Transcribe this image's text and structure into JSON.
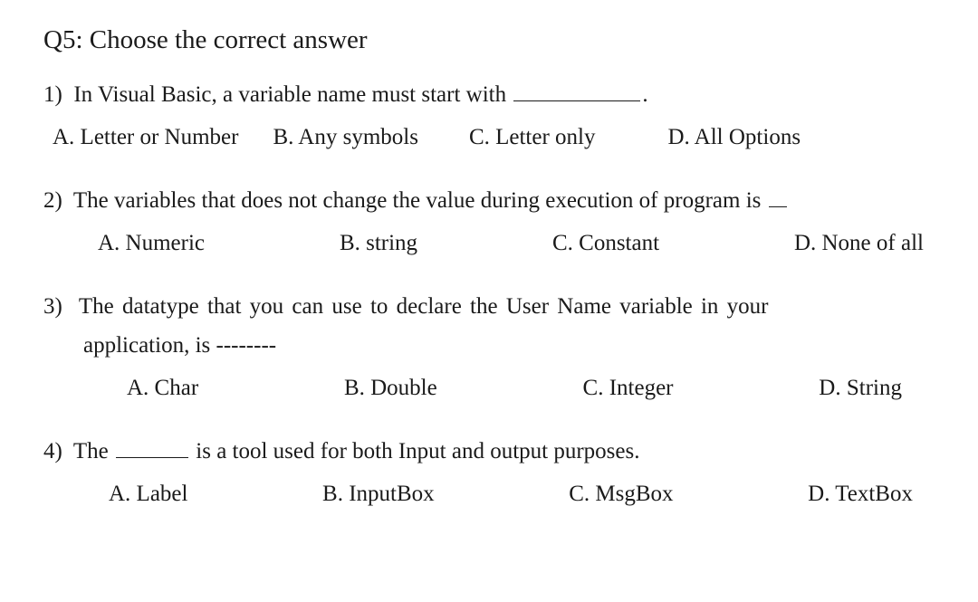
{
  "title": "Q5: Choose the correct answer",
  "questions": [
    {
      "number": "1)",
      "text_before": "In Visual Basic, a variable name must start with ",
      "text_after": ".",
      "options": {
        "A": "A.  Letter or Number",
        "B": "B.  Any symbols",
        "C": "C.  Letter only",
        "D": "D.  All Options"
      }
    },
    {
      "number": "2)",
      "text_before": "The variables that does not change the value during execution of program is ",
      "text_after": "",
      "options": {
        "A": "A. Numeric",
        "B": "B. string",
        "C": "C. Constant",
        "D": "D. None of all"
      }
    },
    {
      "number": "3)",
      "text_line1": "The datatype that you can use to declare the User Name variable in your",
      "text_line2": "application, is --------",
      "options": {
        "A": "A. Char",
        "B": "B. Double",
        "C": "C. Integer",
        "D": "D. String"
      }
    },
    {
      "number": "4)",
      "text_before": "The ",
      "text_after": " is a tool used for both Input and output purposes.",
      "options": {
        "A": "A. Label",
        "B": "B. InputBox",
        "C": "C. MsgBox",
        "D": "D. TextBox"
      }
    }
  ]
}
